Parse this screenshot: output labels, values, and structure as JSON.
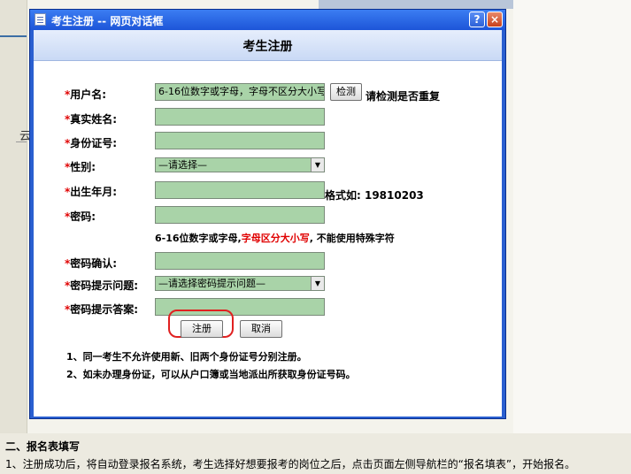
{
  "dialog": {
    "title": "考生注册 -- 网页对话框",
    "help_label": "?",
    "close_label": "×",
    "heading": "考生注册"
  },
  "form": {
    "username_label": "用户名:",
    "username_value": "6-16位数字或字母，字母不区分大小写",
    "check_button": "检测",
    "check_hint": "请检测是否重复",
    "realname_label": "真实姓名:",
    "idcard_label": "身份证号:",
    "gender_label": "性别:",
    "gender_selected": "—请选择—",
    "birth_label": "出生年月:",
    "birth_hint": "格式如: 19810203",
    "password_label": "密码:",
    "password_hint_a": "6-16位数字或字母,",
    "password_hint_b": "字母区分大小写",
    "password_hint_c": ", 不能使用特殊字符",
    "confirm_label": "密码确认:",
    "question_label": "密码提示问题:",
    "question_selected": "—请选择密码提示问题—",
    "answer_label": "密码提示答案:",
    "register_button": "注册",
    "cancel_button": "取消",
    "note1": "1、同一考生不允许使用新、旧两个身份证号分别注册。",
    "note2": "2、如未办理身份证，可以从户口簿或当地派出所获取身份证号码。",
    "required_mark": "*"
  },
  "page": {
    "section_heading": "二、报名表填写",
    "section_text": "1、注册成功后，将自动登录报名系统，考生选择好想要报考的岗位之后，点击页面左侧导航栏的“报名填表”，开始报名。",
    "side_char": "云"
  },
  "colors": {
    "field_bg": "#a9d3a8",
    "title_blue": "#2a5fd0",
    "required": "#e00000"
  }
}
